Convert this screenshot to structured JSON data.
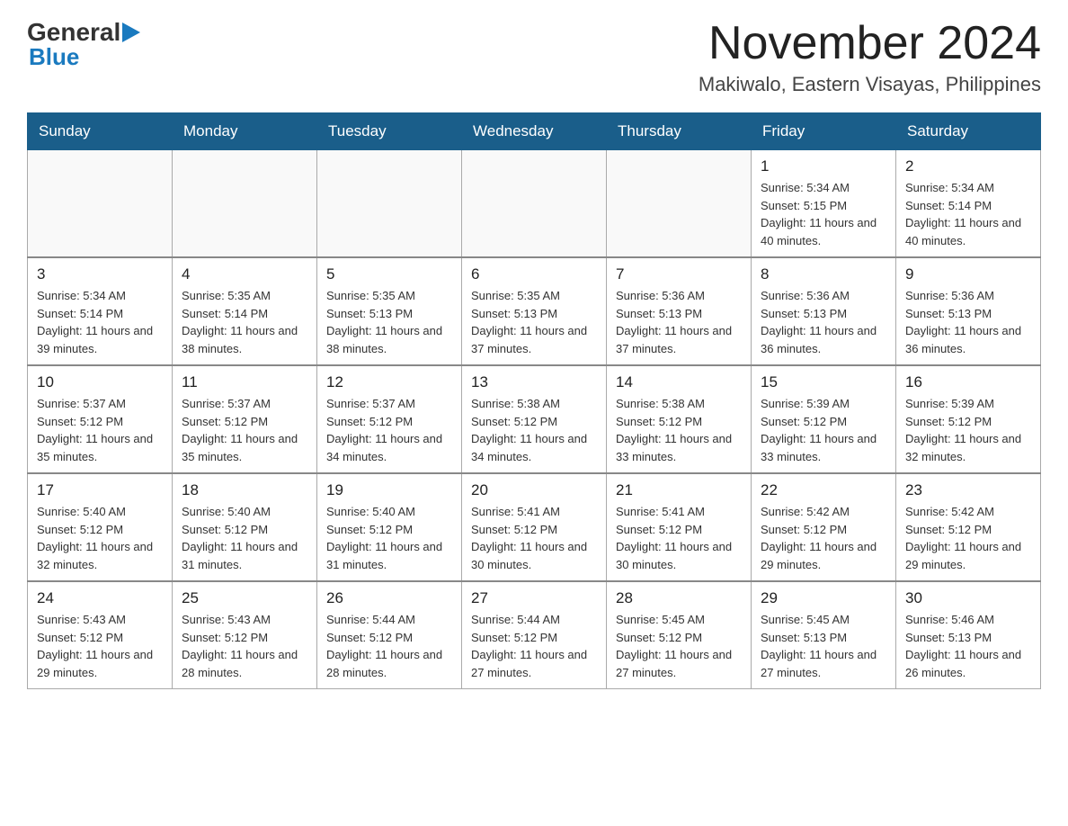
{
  "header": {
    "logo_general": "General",
    "logo_blue": "Blue",
    "month_title": "November 2024",
    "location": "Makiwalo, Eastern Visayas, Philippines"
  },
  "days_of_week": [
    "Sunday",
    "Monday",
    "Tuesday",
    "Wednesday",
    "Thursday",
    "Friday",
    "Saturday"
  ],
  "weeks": [
    [
      {
        "day": "",
        "info": ""
      },
      {
        "day": "",
        "info": ""
      },
      {
        "day": "",
        "info": ""
      },
      {
        "day": "",
        "info": ""
      },
      {
        "day": "",
        "info": ""
      },
      {
        "day": "1",
        "info": "Sunrise: 5:34 AM\nSunset: 5:15 PM\nDaylight: 11 hours and 40 minutes."
      },
      {
        "day": "2",
        "info": "Sunrise: 5:34 AM\nSunset: 5:14 PM\nDaylight: 11 hours and 40 minutes."
      }
    ],
    [
      {
        "day": "3",
        "info": "Sunrise: 5:34 AM\nSunset: 5:14 PM\nDaylight: 11 hours and 39 minutes."
      },
      {
        "day": "4",
        "info": "Sunrise: 5:35 AM\nSunset: 5:14 PM\nDaylight: 11 hours and 38 minutes."
      },
      {
        "day": "5",
        "info": "Sunrise: 5:35 AM\nSunset: 5:13 PM\nDaylight: 11 hours and 38 minutes."
      },
      {
        "day": "6",
        "info": "Sunrise: 5:35 AM\nSunset: 5:13 PM\nDaylight: 11 hours and 37 minutes."
      },
      {
        "day": "7",
        "info": "Sunrise: 5:36 AM\nSunset: 5:13 PM\nDaylight: 11 hours and 37 minutes."
      },
      {
        "day": "8",
        "info": "Sunrise: 5:36 AM\nSunset: 5:13 PM\nDaylight: 11 hours and 36 minutes."
      },
      {
        "day": "9",
        "info": "Sunrise: 5:36 AM\nSunset: 5:13 PM\nDaylight: 11 hours and 36 minutes."
      }
    ],
    [
      {
        "day": "10",
        "info": "Sunrise: 5:37 AM\nSunset: 5:12 PM\nDaylight: 11 hours and 35 minutes."
      },
      {
        "day": "11",
        "info": "Sunrise: 5:37 AM\nSunset: 5:12 PM\nDaylight: 11 hours and 35 minutes."
      },
      {
        "day": "12",
        "info": "Sunrise: 5:37 AM\nSunset: 5:12 PM\nDaylight: 11 hours and 34 minutes."
      },
      {
        "day": "13",
        "info": "Sunrise: 5:38 AM\nSunset: 5:12 PM\nDaylight: 11 hours and 34 minutes."
      },
      {
        "day": "14",
        "info": "Sunrise: 5:38 AM\nSunset: 5:12 PM\nDaylight: 11 hours and 33 minutes."
      },
      {
        "day": "15",
        "info": "Sunrise: 5:39 AM\nSunset: 5:12 PM\nDaylight: 11 hours and 33 minutes."
      },
      {
        "day": "16",
        "info": "Sunrise: 5:39 AM\nSunset: 5:12 PM\nDaylight: 11 hours and 32 minutes."
      }
    ],
    [
      {
        "day": "17",
        "info": "Sunrise: 5:40 AM\nSunset: 5:12 PM\nDaylight: 11 hours and 32 minutes."
      },
      {
        "day": "18",
        "info": "Sunrise: 5:40 AM\nSunset: 5:12 PM\nDaylight: 11 hours and 31 minutes."
      },
      {
        "day": "19",
        "info": "Sunrise: 5:40 AM\nSunset: 5:12 PM\nDaylight: 11 hours and 31 minutes."
      },
      {
        "day": "20",
        "info": "Sunrise: 5:41 AM\nSunset: 5:12 PM\nDaylight: 11 hours and 30 minutes."
      },
      {
        "day": "21",
        "info": "Sunrise: 5:41 AM\nSunset: 5:12 PM\nDaylight: 11 hours and 30 minutes."
      },
      {
        "day": "22",
        "info": "Sunrise: 5:42 AM\nSunset: 5:12 PM\nDaylight: 11 hours and 29 minutes."
      },
      {
        "day": "23",
        "info": "Sunrise: 5:42 AM\nSunset: 5:12 PM\nDaylight: 11 hours and 29 minutes."
      }
    ],
    [
      {
        "day": "24",
        "info": "Sunrise: 5:43 AM\nSunset: 5:12 PM\nDaylight: 11 hours and 29 minutes."
      },
      {
        "day": "25",
        "info": "Sunrise: 5:43 AM\nSunset: 5:12 PM\nDaylight: 11 hours and 28 minutes."
      },
      {
        "day": "26",
        "info": "Sunrise: 5:44 AM\nSunset: 5:12 PM\nDaylight: 11 hours and 28 minutes."
      },
      {
        "day": "27",
        "info": "Sunrise: 5:44 AM\nSunset: 5:12 PM\nDaylight: 11 hours and 27 minutes."
      },
      {
        "day": "28",
        "info": "Sunrise: 5:45 AM\nSunset: 5:12 PM\nDaylight: 11 hours and 27 minutes."
      },
      {
        "day": "29",
        "info": "Sunrise: 5:45 AM\nSunset: 5:13 PM\nDaylight: 11 hours and 27 minutes."
      },
      {
        "day": "30",
        "info": "Sunrise: 5:46 AM\nSunset: 5:13 PM\nDaylight: 11 hours and 26 minutes."
      }
    ]
  ]
}
